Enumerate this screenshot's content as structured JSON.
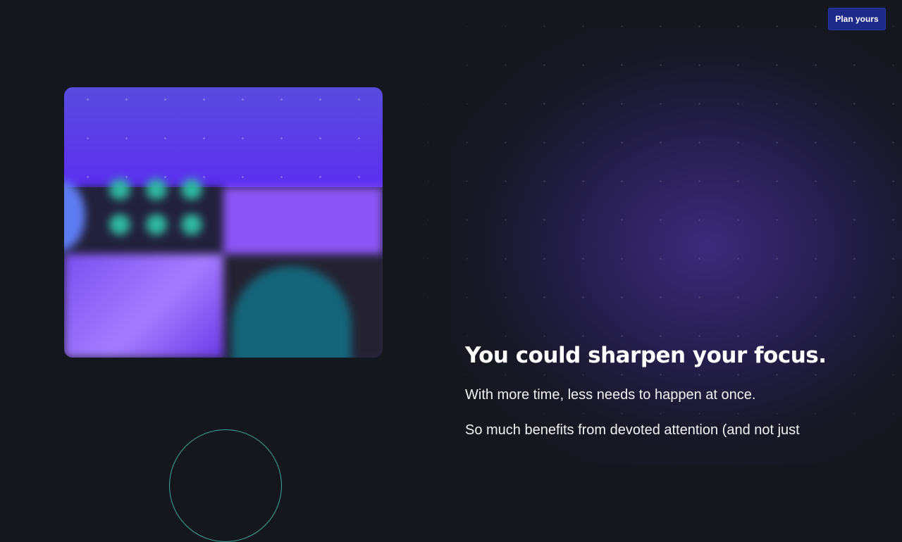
{
  "header": {
    "cta_label": "Plan yours"
  },
  "hero": {
    "heading": "You could sharpen your focus.",
    "subheading": "With more time, less needs to happen at once.",
    "paragraph": "So much benefits from devoted attention (and not just"
  },
  "colors": {
    "background": "#15171e",
    "cta_background": "#1e2a8a",
    "accent_purple": "#5a2ff0",
    "accent_teal": "#2fb8a2"
  }
}
